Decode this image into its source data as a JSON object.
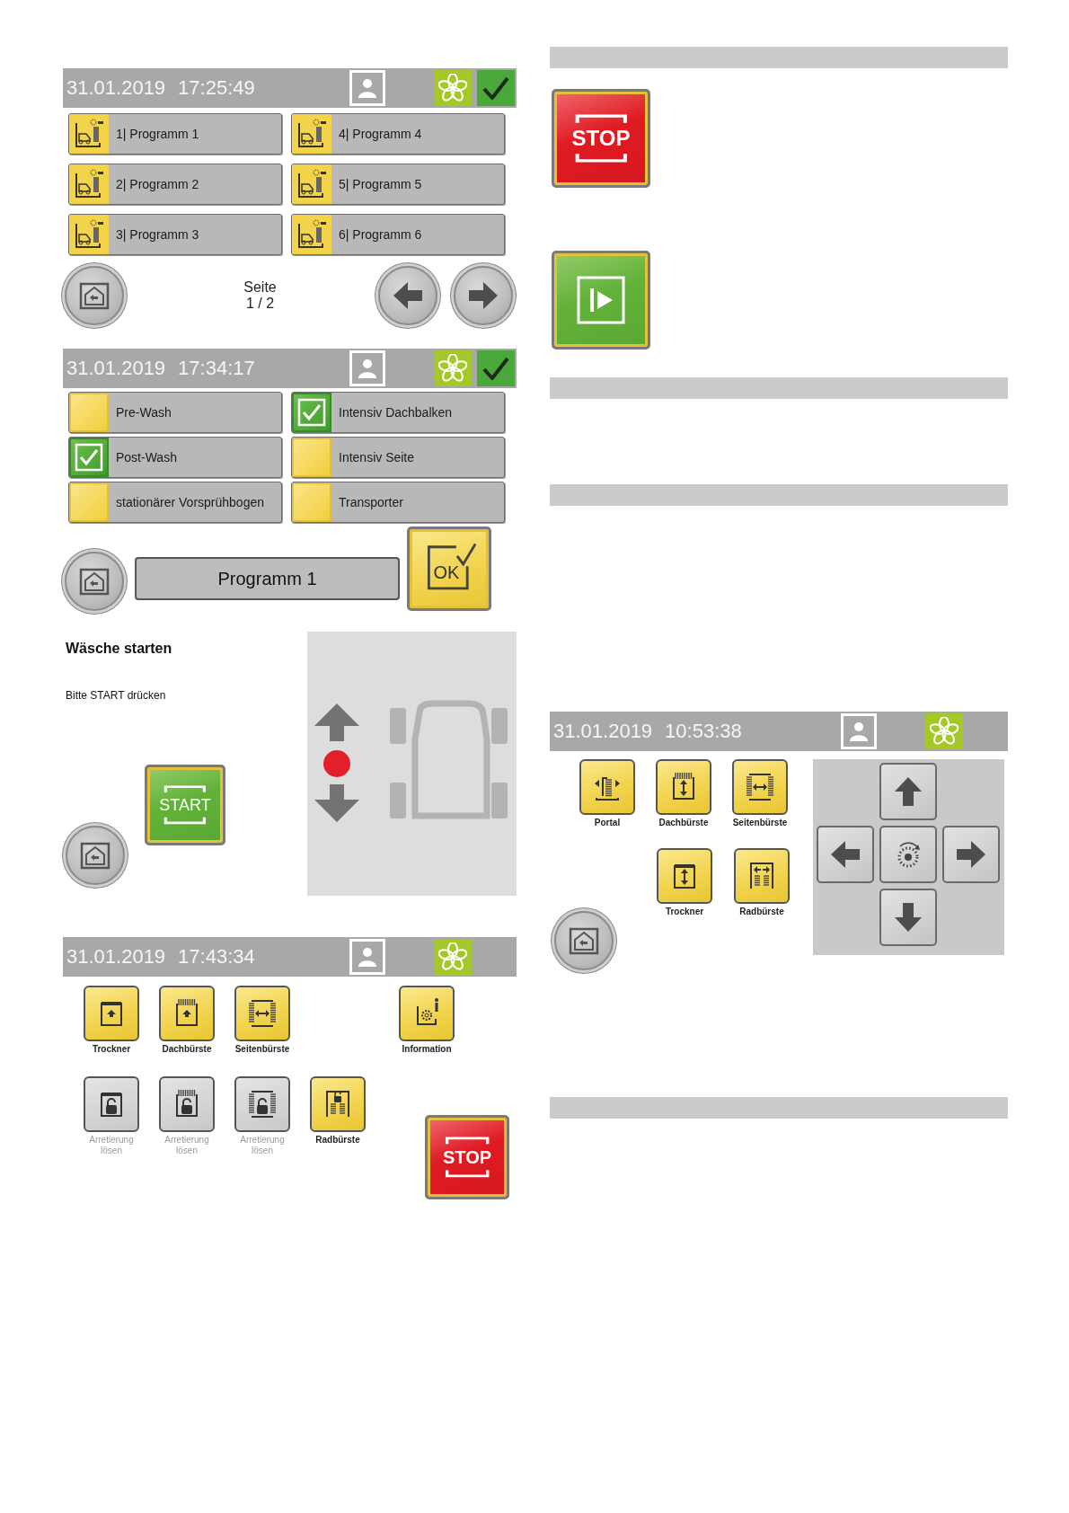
{
  "program_screen": {
    "header": {
      "date": "31.01.2019",
      "time": "17:25:49",
      "confirmed": true
    },
    "programs": [
      {
        "label": "1| Programm 1"
      },
      {
        "label": "2| Programm 2"
      },
      {
        "label": "3| Programm 3"
      },
      {
        "label": "4| Programm 4"
      },
      {
        "label": "5| Programm 5"
      },
      {
        "label": "6| Programm 6"
      }
    ],
    "page_label": "Seite",
    "page_number": "1 / 2"
  },
  "options_screen": {
    "header": {
      "date": "31.01.2019",
      "time": "17:34:17",
      "confirmed": true
    },
    "options": [
      {
        "label": "Pre-Wash",
        "checked": false
      },
      {
        "label": "Post-Wash",
        "checked": true
      },
      {
        "label": "stationärer Vorsprühbogen",
        "checked": false
      },
      {
        "label": "Intensiv Dachbalken",
        "checked": true
      },
      {
        "label": "Intensiv Seite",
        "checked": false
      },
      {
        "label": "Transporter",
        "checked": false
      }
    ],
    "program_name": "Programm 1",
    "ok_label": "OK"
  },
  "start_screen": {
    "title": "Wäsche starten",
    "instruction": "Bitte START drücken",
    "start_label": "START"
  },
  "manual_screen": {
    "header": {
      "date": "31.01.2019",
      "time": "17:43:34",
      "confirmed": false
    },
    "functions": [
      {
        "label": "Trockner",
        "kind": "dryer",
        "disabled": false
      },
      {
        "label": "Dachbürste",
        "kind": "roofbrush",
        "disabled": false
      },
      {
        "label": "Seitenbürste",
        "kind": "sidebrush",
        "disabled": false
      }
    ],
    "info": {
      "label": "Information",
      "kind": "info",
      "disabled": false
    },
    "lock_functions": [
      {
        "label": "Arretierung lösen",
        "kind": "dryer",
        "disabled": true
      },
      {
        "label": "Arretierung lösen",
        "kind": "roofbrush",
        "disabled": true
      },
      {
        "label": "Arretierung lösen",
        "kind": "sidebrush",
        "disabled": true
      },
      {
        "label": "Radbürste",
        "kind": "wheelbrush",
        "disabled": false
      }
    ],
    "stop_label": "STOP"
  },
  "stop_button": {
    "label": "STOP"
  },
  "jog_screen": {
    "header": {
      "date": "31.01.2019",
      "time": "10:53:38",
      "confirmed": false
    },
    "top_functions": [
      {
        "label": "Portal",
        "kind": "portal",
        "disabled": false
      },
      {
        "label": "Dachbürste",
        "kind": "roofbrush",
        "disabled": false
      },
      {
        "label": "Seitenbürste",
        "kind": "sidebrush",
        "disabled": false
      }
    ],
    "bottom_functions": [
      {
        "label": "Trockner",
        "kind": "dryer",
        "disabled": false
      },
      {
        "label": "Radbürste",
        "kind": "wheelbrush",
        "disabled": false
      }
    ]
  }
}
